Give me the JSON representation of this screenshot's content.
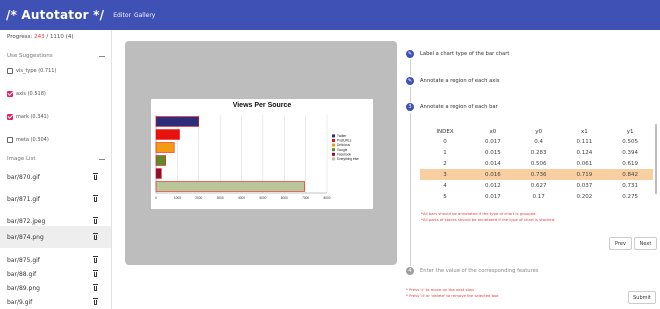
{
  "header": {
    "title": "/* Autotator */",
    "nav": [
      "Editor",
      "Gallery"
    ]
  },
  "sidebar": {
    "progress_label": "Progress:",
    "progress_done": "243",
    "progress_sep": "/",
    "progress_total": "1110",
    "progress_paren": "(4)",
    "suggestions_title": "Use Suggestions",
    "suggestions": [
      {
        "label": "vis_type (0.711)",
        "checked": false
      },
      {
        "label": "axis (0.518)",
        "checked": true
      },
      {
        "label": "mark (0.341)",
        "checked": true
      },
      {
        "label": "meta (0.304)",
        "checked": false
      }
    ],
    "image_list_title": "Image List",
    "images": [
      "bar/870.gif",
      "bar/871.gif",
      "bar/872.jpeg",
      "bar/874.png",
      "bar/875.gif",
      "bar/88.gif",
      "bar/89.png",
      "bar/9.gif"
    ],
    "selected_image": "bar/874.png"
  },
  "steps": [
    {
      "num": "1",
      "label": "Label a chart type of the bar chart",
      "done": true
    },
    {
      "num": "2",
      "label": "Annotate a region of each axis",
      "done": true
    },
    {
      "num": "3",
      "label": "Annotate a region of each bar",
      "done": false,
      "active": true
    },
    {
      "num": "4",
      "label": "Enter the value of the corresponding features",
      "done": false
    }
  ],
  "table": {
    "headers": [
      "INDEX",
      "x0",
      "y0",
      "x1",
      "y1"
    ],
    "rows": [
      [
        "0",
        "0.017",
        "0.4",
        "0.111",
        "0.505"
      ],
      [
        "1",
        "0.015",
        "0.283",
        "0.124",
        "0.394"
      ],
      [
        "2",
        "0.014",
        "0.506",
        "0.061",
        "0.619"
      ],
      [
        "3",
        "0.016",
        "0.736",
        "0.719",
        "0.842"
      ],
      [
        "4",
        "0.012",
        "0.627",
        "0.037",
        "0.731"
      ],
      [
        "5",
        "0.017",
        "0.17",
        "0.202",
        "0.275"
      ]
    ],
    "highlight_row": 3
  },
  "warnings": [
    "*All bars should be annotated if the type of chart is grouped.",
    "*All parts of stacks should be annotated if the type of chart is stacked."
  ],
  "buttons": {
    "prev": "Prev",
    "next": "Next",
    "submit": "Submit"
  },
  "footer_hints": [
    "* Press 'c' to move on the next step",
    "* Press 'd' or 'delete' to remove the selected box"
  ],
  "colors": {
    "header": "#3f51b5",
    "accent": "#e91e63",
    "highlight": "#f8cfa0",
    "warning": "#e53935"
  },
  "chart_data": {
    "type": "bar",
    "orientation": "horizontal",
    "title": "Views Per Source",
    "categories": [
      "Twitter",
      "PostURLs",
      "Delicious",
      "Google",
      "Facebook",
      "Everything else"
    ],
    "values": [
      2000,
      1100,
      850,
      450,
      250,
      6950
    ],
    "colors": [
      "#2e2d7a",
      "#e8110e",
      "#f39c12",
      "#5d8a2c",
      "#8b1030",
      "#b8c69a"
    ],
    "xlim": [
      0,
      8000
    ],
    "xticks": [
      "0",
      "1000",
      "2000",
      "3000",
      "4000",
      "5000",
      "6000",
      "7000",
      "8000"
    ],
    "grid": true,
    "legend": "right"
  }
}
